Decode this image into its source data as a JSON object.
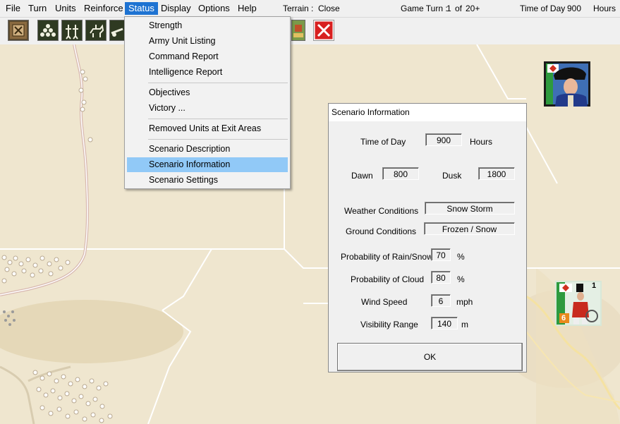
{
  "menubar": {
    "items": [
      "File",
      "Turn",
      "Units",
      "Reinforce",
      "Status",
      "Display",
      "Options",
      "Help"
    ],
    "active": "Status"
  },
  "statusbar": {
    "terrain_label": "Terrain :",
    "terrain_value": "Close",
    "turn_label": "Game Turn :",
    "turn_value": "1",
    "turn_of": "of",
    "turn_total": "20+",
    "time_label": "Time of Day",
    "time_value": "900",
    "time_unit": "Hours"
  },
  "toolbar": {
    "buttons": [
      "map-overview-icon",
      "infantry-stack-icon",
      "two-soldiers-icon",
      "cavalry-icon",
      "artillery-icon",
      "terrain-icon",
      "close-red-x-icon"
    ]
  },
  "status_menu": {
    "items": [
      {
        "label": "Strength"
      },
      {
        "label": "Army Unit Listing"
      },
      {
        "label": "Command Report"
      },
      {
        "label": "Intelligence Report"
      },
      {
        "label": "Objectives"
      },
      {
        "label": "Victory ..."
      },
      {
        "label": "Removed Units at Exit Areas"
      },
      {
        "label": "Scenario Description"
      },
      {
        "label": "Scenario Information"
      },
      {
        "label": "Scenario Settings"
      }
    ],
    "highlighted": "Scenario Information"
  },
  "dialog": {
    "title": "Scenario Information",
    "time_of_day_label": "Time of Day",
    "time_of_day_value": "900",
    "time_of_day_unit": "Hours",
    "dawn_label": "Dawn",
    "dawn_value": "800",
    "dusk_label": "Dusk",
    "dusk_value": "1800",
    "weather_label": "Weather Conditions",
    "weather_value": "Snow Storm",
    "ground_label": "Ground Conditions",
    "ground_value": "Frozen / Snow",
    "rain_label": "Probability of Rain/Snow",
    "rain_value": "70",
    "rain_unit": "%",
    "cloud_label": "Probability of Cloud",
    "cloud_value": "80",
    "cloud_unit": "%",
    "wind_label": "Wind Speed",
    "wind_value": "6",
    "wind_unit": "mph",
    "visibility_label": "Visibility Range",
    "visibility_value": "140",
    "visibility_unit": "m",
    "ok_label": "OK"
  },
  "units": {
    "soldier_strength": "1",
    "soldier_value": "6"
  },
  "colors": {
    "menu_active": "#1e73d2",
    "menu_highlight": "#91c9f7",
    "map_background": "#efe6cf",
    "hex_line": "#ffffff",
    "road": "#c8a8a0",
    "red_x": "#d82020"
  }
}
